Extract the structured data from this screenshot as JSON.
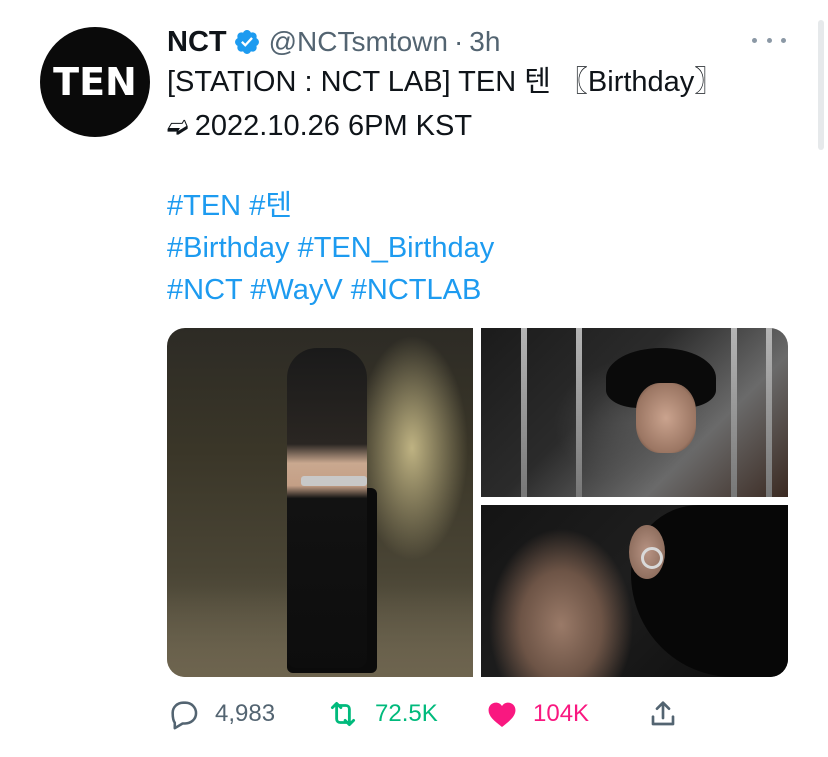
{
  "avatar": {
    "text": "TEN"
  },
  "header": {
    "display_name": "NCT",
    "handle": "@NCTsmtown",
    "separator": "·",
    "time": "3h"
  },
  "tweet": {
    "line1": "[STATION : NCT LAB] TEN 텐 〖Birthday〗",
    "line2_arrow": "➫",
    "line2": "2022.10.26 6PM KST",
    "hashtags": [
      [
        "#TEN",
        "#텐"
      ],
      [
        "#Birthday",
        "#TEN_Birthday"
      ],
      [
        "#NCT",
        "#WayV",
        "#NCTLAB"
      ]
    ]
  },
  "media": {
    "photos": [
      "photo-1",
      "photo-2",
      "photo-3"
    ]
  },
  "actions": {
    "reply_count": "4,983",
    "retweet_count": "72.5K",
    "like_count": "104K"
  },
  "colors": {
    "accent": "#1d9bf0",
    "verified": "#1d9bf0",
    "retweet": "#00ba7c",
    "like": "#f91880",
    "muted": "#536471"
  },
  "icons": {
    "verified": "verified-badge-icon",
    "more": "more-options-icon",
    "reply": "reply-icon",
    "retweet": "retweet-icon",
    "like": "heart-icon",
    "share": "share-icon"
  }
}
